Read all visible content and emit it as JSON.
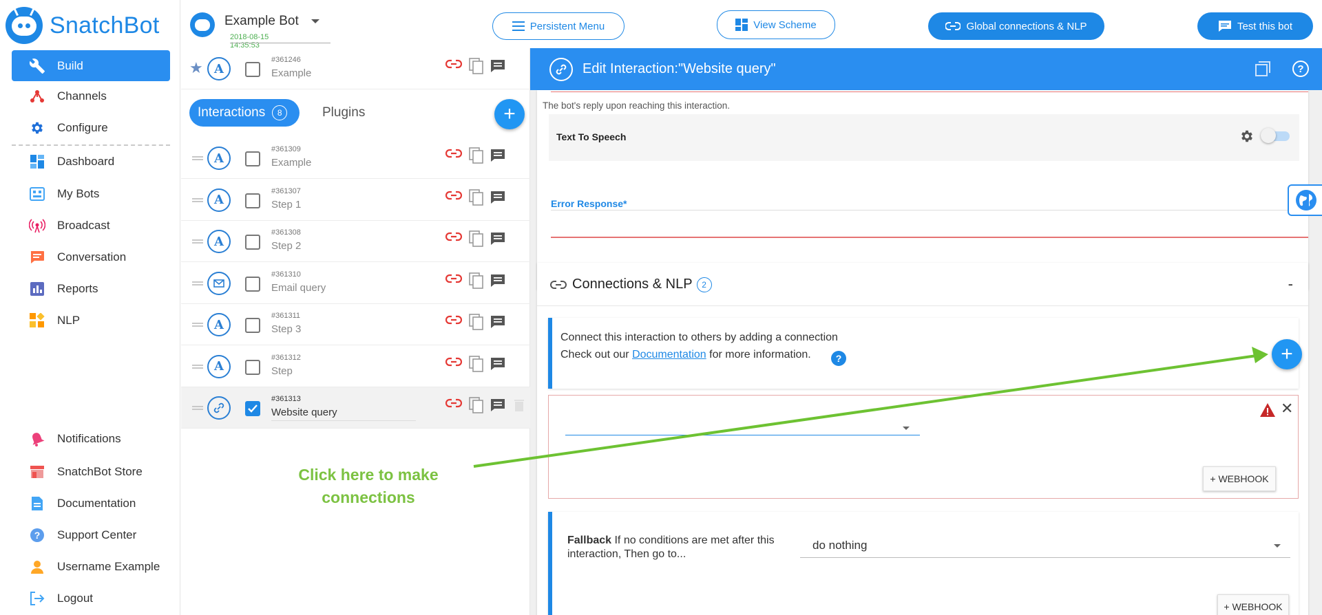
{
  "brand": {
    "name": "SnatchBot"
  },
  "sidebar": {
    "build": {
      "label": "Build",
      "icon": "wrench-icon"
    },
    "top_items": [
      {
        "label": "Channels",
        "icon": "channels-icon"
      },
      {
        "label": "Configure",
        "icon": "gear-icon"
      }
    ],
    "main_items": [
      {
        "label": "Dashboard",
        "icon": "dashboard-icon"
      },
      {
        "label": "My Bots",
        "icon": "bots-icon"
      },
      {
        "label": "Broadcast",
        "icon": "broadcast-icon"
      },
      {
        "label": "Conversation",
        "icon": "chat-icon"
      },
      {
        "label": "Reports",
        "icon": "reports-icon"
      },
      {
        "label": "NLP",
        "icon": "nlp-icon"
      }
    ],
    "bottom_items": [
      {
        "label": "Notifications",
        "icon": "bell-icon"
      },
      {
        "label": "SnatchBot Store",
        "icon": "store-icon"
      },
      {
        "label": "Documentation",
        "icon": "document-icon"
      },
      {
        "label": "Support Center",
        "icon": "help-icon"
      },
      {
        "label": "Username Example",
        "icon": "user-icon"
      },
      {
        "label": "Logout",
        "icon": "logout-icon"
      }
    ]
  },
  "header": {
    "bot_name": "Example Bot",
    "bot_date": "2018-08-15 14:35:53",
    "persistent_menu": "Persistent Menu",
    "view_scheme": "View Scheme",
    "global_connections": "Global connections & NLP",
    "test_bot": "Test this bot"
  },
  "interactions": {
    "starred": {
      "id": "#361246",
      "name": "Example",
      "icon": "A"
    },
    "tabs": {
      "interactions_label": "Interactions",
      "interactions_count": "8",
      "plugins_label": "Plugins"
    },
    "rows": [
      {
        "id": "#361309",
        "name": "Example",
        "icon": "A",
        "checked": false
      },
      {
        "id": "#361307",
        "name": "Step 1",
        "icon": "A",
        "checked": false
      },
      {
        "id": "#361308",
        "name": "Step 2",
        "icon": "A",
        "checked": false
      },
      {
        "id": "#361310",
        "name": "Email query",
        "icon": "email",
        "checked": false
      },
      {
        "id": "#361311",
        "name": "Step 3",
        "icon": "A",
        "checked": false
      },
      {
        "id": "#361312",
        "name": "Step",
        "icon": "A",
        "checked": false
      },
      {
        "id": "#361313",
        "name": "Website query",
        "icon": "link",
        "checked": true
      }
    ]
  },
  "editor": {
    "title": "Edit Interaction:\"Website query\"",
    "reply_hint": "The bot's reply upon reaching this interaction.",
    "tts_label": "Text To Speech",
    "error_response_label": "Error Response*",
    "connections_title": "Connections & NLP",
    "connections_count": "2",
    "collapse_symbol": "-",
    "info_line1": "Connect this interaction to others by adding a connection",
    "info_line2_pre": "Check out our ",
    "info_link": "Documentation",
    "info_line2_post": " for more information.",
    "webhook_label": "+ WEBHOOK",
    "fallback_bold": "Fallback",
    "fallback_text": " If no conditions are met after this interaction, Then go to...",
    "fallback_value": "do nothing"
  },
  "annotation": {
    "line1": "Click here to make",
    "line2": "connections",
    "color": "#7cc242"
  },
  "colors": {
    "primary": "#1e88e5",
    "header_blue": "#2a8ef0",
    "danger": "#e53935"
  }
}
